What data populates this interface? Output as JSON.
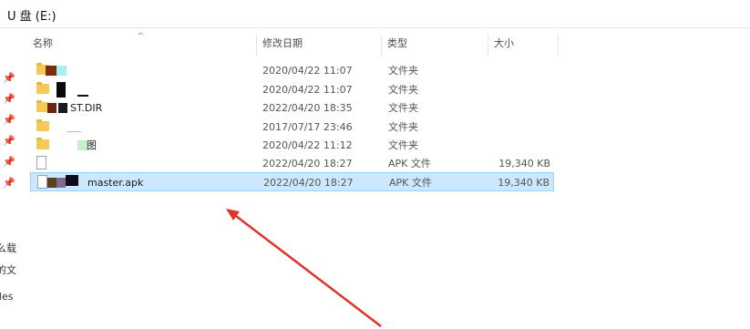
{
  "window": {
    "title": "U 盘 (E:)"
  },
  "columns": {
    "name": "名称",
    "date": "修改日期",
    "type": "类型",
    "size": "大小"
  },
  "left_clipped_text": [
    "么载",
    "的文",
    "files"
  ],
  "rows": [
    {
      "name": "",
      "date": "2020/04/22 11:07",
      "type": "文件夹",
      "size": "",
      "icon": "folder-icon"
    },
    {
      "name": "",
      "date": "2020/04/22 11:07",
      "type": "文件夹",
      "size": "",
      "icon": "folder-icon"
    },
    {
      "name": "ST.DIR",
      "date": "2022/04/20 18:35",
      "type": "文件夹",
      "size": "",
      "icon": "folder-icon"
    },
    {
      "name": "",
      "date": "2017/07/17 23:46",
      "type": "文件夹",
      "size": "",
      "icon": "folder-icon"
    },
    {
      "name": "图",
      "date": "2020/04/22 11:12",
      "type": "文件夹",
      "size": "",
      "icon": "folder-icon"
    },
    {
      "name": "",
      "date": "2022/04/20 18:27",
      "type": "APK 文件",
      "size": "19,340 KB",
      "icon": "file-icon"
    },
    {
      "name": "master.apk",
      "date": "2022/04/20 18:27",
      "type": "APK 文件",
      "size": "19,340 KB",
      "icon": "file-icon",
      "selected": true
    }
  ],
  "colors": {
    "selection_bg": "#cce8ff",
    "selection_border": "#99d1ff",
    "annotation_arrow": "#e0322a"
  }
}
